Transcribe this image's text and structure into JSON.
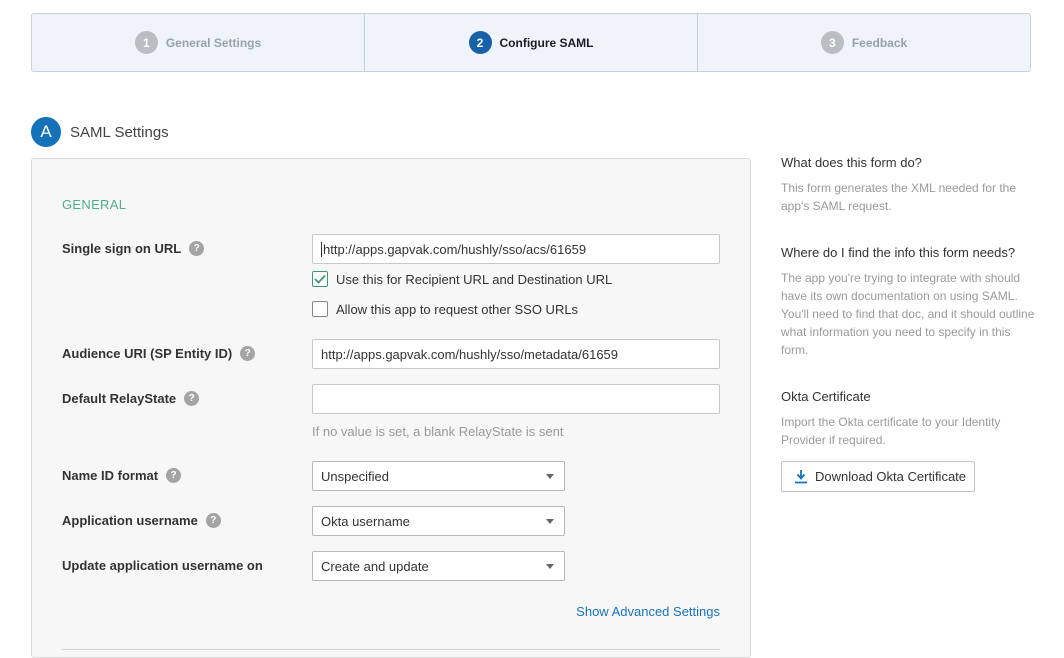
{
  "wizard": {
    "steps": [
      {
        "num": "1",
        "label": "General Settings"
      },
      {
        "num": "2",
        "label": "Configure SAML"
      },
      {
        "num": "3",
        "label": "Feedback"
      }
    ]
  },
  "section": {
    "badge": "A",
    "title": "SAML Settings"
  },
  "form": {
    "group_title": "GENERAL",
    "sso_url": {
      "label": "Single sign on URL",
      "value": "http://apps.gapvak.com/hushly/sso/acs/61659"
    },
    "recipient_checkbox": {
      "label": "Use this for Recipient URL and Destination URL",
      "checked": true
    },
    "other_sso_checkbox": {
      "label": "Allow this app to request other SSO URLs",
      "checked": false
    },
    "audience_uri": {
      "label": "Audience URI (SP Entity ID)",
      "value": "http://apps.gapvak.com/hushly/sso/metadata/61659"
    },
    "relay_state": {
      "label": "Default RelayState",
      "value": "",
      "hint": "If no value is set, a blank RelayState is sent"
    },
    "name_id_format": {
      "label": "Name ID format",
      "value": "Unspecified"
    },
    "app_username": {
      "label": "Application username",
      "value": "Okta username"
    },
    "update_username": {
      "label": "Update application username on",
      "value": "Create and update"
    },
    "advanced_link": "Show Advanced Settings",
    "help_glyph": "?"
  },
  "sidebar": {
    "q1": {
      "title": "What does this form do?",
      "body": "This form generates the XML needed for the app's SAML request."
    },
    "q2": {
      "title": "Where do I find the info this form needs?",
      "body": "The app you're trying to integrate with should have its own documentation on using SAML. You'll need to find that doc, and it should outline what information you need to specify in this form."
    },
    "cert": {
      "title": "Okta Certificate",
      "body": "Import the Okta certificate to your Identity Provider if required.",
      "button": "Download Okta Certificate"
    }
  },
  "colors": {
    "accent": "#1662a8",
    "group_title": "#4fae8d",
    "link": "#1a74b9"
  }
}
